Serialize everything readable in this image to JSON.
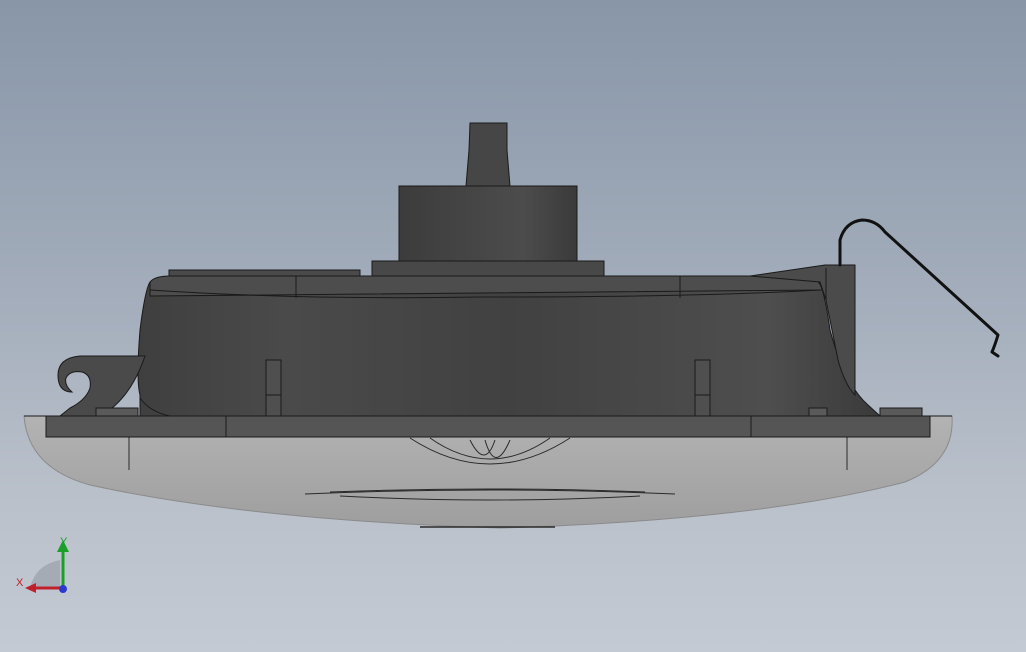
{
  "viewport": {
    "background_top": "#8896a8",
    "background_bottom": "#c4cad3"
  },
  "model": {
    "body_color": "#454545",
    "edge_color": "#1a1a1a",
    "lens_color": "#a8a8a8"
  },
  "triad": {
    "x_label": "X",
    "y_label": "Y",
    "x_color": "#c0202a",
    "y_color": "#1aa02a",
    "z_color": "#2a3acc"
  }
}
